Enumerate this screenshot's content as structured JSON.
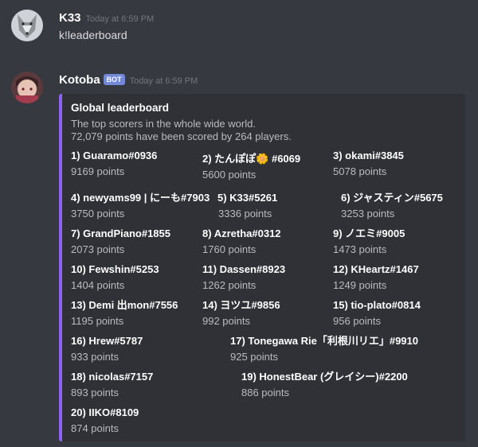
{
  "messages": [
    {
      "username": "K33",
      "timestamp": "Today at 6:59 PM",
      "text": "k!leaderboard"
    },
    {
      "username": "Kotoba",
      "bot_tag": "BOT",
      "timestamp": "Today at 6:59 PM"
    }
  ],
  "embed": {
    "accent_color": "#8e62f5",
    "title": "Global leaderboard",
    "description_line1": "The top scorers in the whole wide world.",
    "description_line2": "72,079 points have been scored by 264 players.",
    "fields": [
      {
        "name": "1) Guaramo#0936",
        "value": "9169 points"
      },
      {
        "name": "2) たんぽぽ🌼 #6069",
        "value": "5600 points"
      },
      {
        "name": "3) okami#3845",
        "value": "5078 points"
      },
      {
        "name": "4) newyams99 | にーも#7903",
        "value": "3750 points"
      },
      {
        "name": "5) K33#5261",
        "value": "3336 points"
      },
      {
        "name": "6) ジャスティン#5675",
        "value": "3253 points"
      },
      {
        "name": "7) GrandPiano#1855",
        "value": "2073 points"
      },
      {
        "name": "8) Azretha#0312",
        "value": "1760 points"
      },
      {
        "name": "9) ノエミ#9005",
        "value": "1473 points"
      },
      {
        "name": "10) Fewshin#5253",
        "value": "1404 points"
      },
      {
        "name": "11) Dassen#8923",
        "value": "1262 points"
      },
      {
        "name": "12) KHeartz#1467",
        "value": "1249 points"
      },
      {
        "name": "13) Demi 出mon#7556",
        "value": "1195 points"
      },
      {
        "name": "14) ヨツユ#9856",
        "value": "992 points"
      },
      {
        "name": "15) tio-plato#0814",
        "value": "956 points"
      },
      {
        "name": "16) Hrew#5787",
        "value": "933 points"
      },
      {
        "name": "17) Tonegawa Rie「利根川リエ」#9910",
        "value": "925 points"
      },
      {
        "name": "18) nicolas#7157",
        "value": "893 points"
      },
      {
        "name": "19) HonestBear (グレイシー)#2200",
        "value": "886 points"
      },
      {
        "name": "20) IIKO#8109",
        "value": "874 points"
      }
    ]
  }
}
